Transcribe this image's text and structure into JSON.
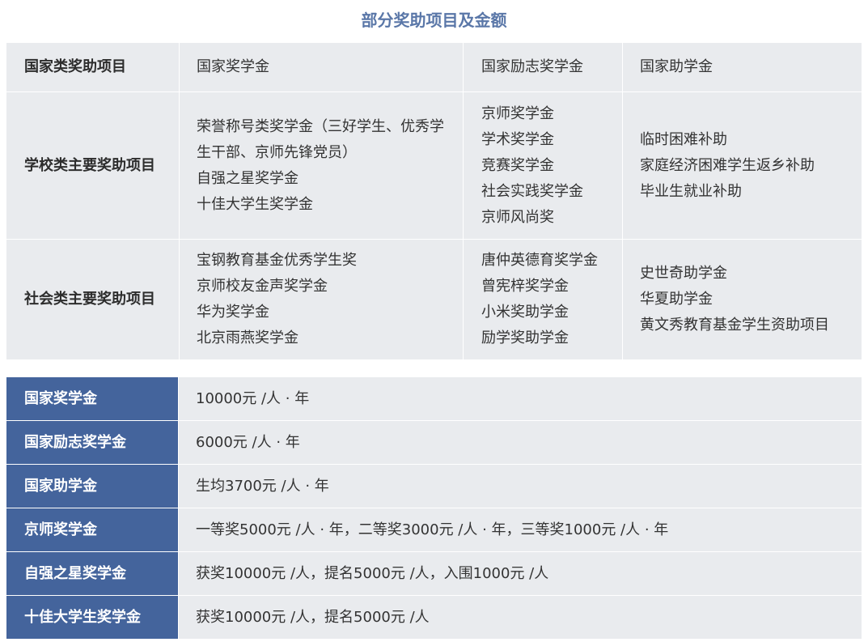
{
  "title": "部分奖助项目及金额",
  "projects": {
    "rows": [
      {
        "category": "国家类奖助项目",
        "col1": [
          "国家奖学金"
        ],
        "col2": [
          "国家励志奖学金"
        ],
        "col3": [
          "国家助学金"
        ]
      },
      {
        "category": "学校类主要奖助项目",
        "col1": [
          "荣誉称号类奖学金（三好学生、优秀学生干部、京师先锋党员）",
          "自强之星奖学金",
          "十佳大学生奖学金"
        ],
        "col2": [
          "京师奖学金",
          "学术奖学金",
          "竞赛奖学金",
          "社会实践奖学金",
          "京师风尚奖"
        ],
        "col3": [
          "临时困难补助",
          "家庭经济困难学生返乡补助",
          "毕业生就业补助"
        ]
      },
      {
        "category": "社会类主要奖助项目",
        "col1": [
          "宝钢教育基金优秀学生奖",
          "京师校友金声奖学金",
          "华为奖学金",
          "北京雨燕奖学金"
        ],
        "col2": [
          "唐仲英德育奖学金",
          "曾宪梓奖学金",
          "小米奖助学金",
          "励学奖助学金"
        ],
        "col3": [
          "史世奇助学金",
          "华夏助学金",
          "黄文秀教育基金学生资助项目"
        ]
      }
    ]
  },
  "amounts": [
    {
      "name": "国家奖学金",
      "value": "10000元 /人 · 年"
    },
    {
      "name": "国家励志奖学金",
      "value": "6000元 /人 · 年"
    },
    {
      "name": "国家助学金",
      "value": "生均3700元 /人 · 年"
    },
    {
      "name": "京师奖学金",
      "value": "一等奖5000元 /人 · 年，二等奖3000元 /人 · 年，三等奖1000元 /人 · 年"
    },
    {
      "name": "自强之星奖学金",
      "value": "获奖10000元 /人，提名5000元 /人，入围1000元 /人"
    },
    {
      "name": "十佳大学生奖学金",
      "value": "获奖10000元 /人，提名5000元 /人"
    }
  ],
  "colors": {
    "title": "#5a77a8",
    "label_bg": "#44649c",
    "cell_bg": "#e9ebee"
  }
}
